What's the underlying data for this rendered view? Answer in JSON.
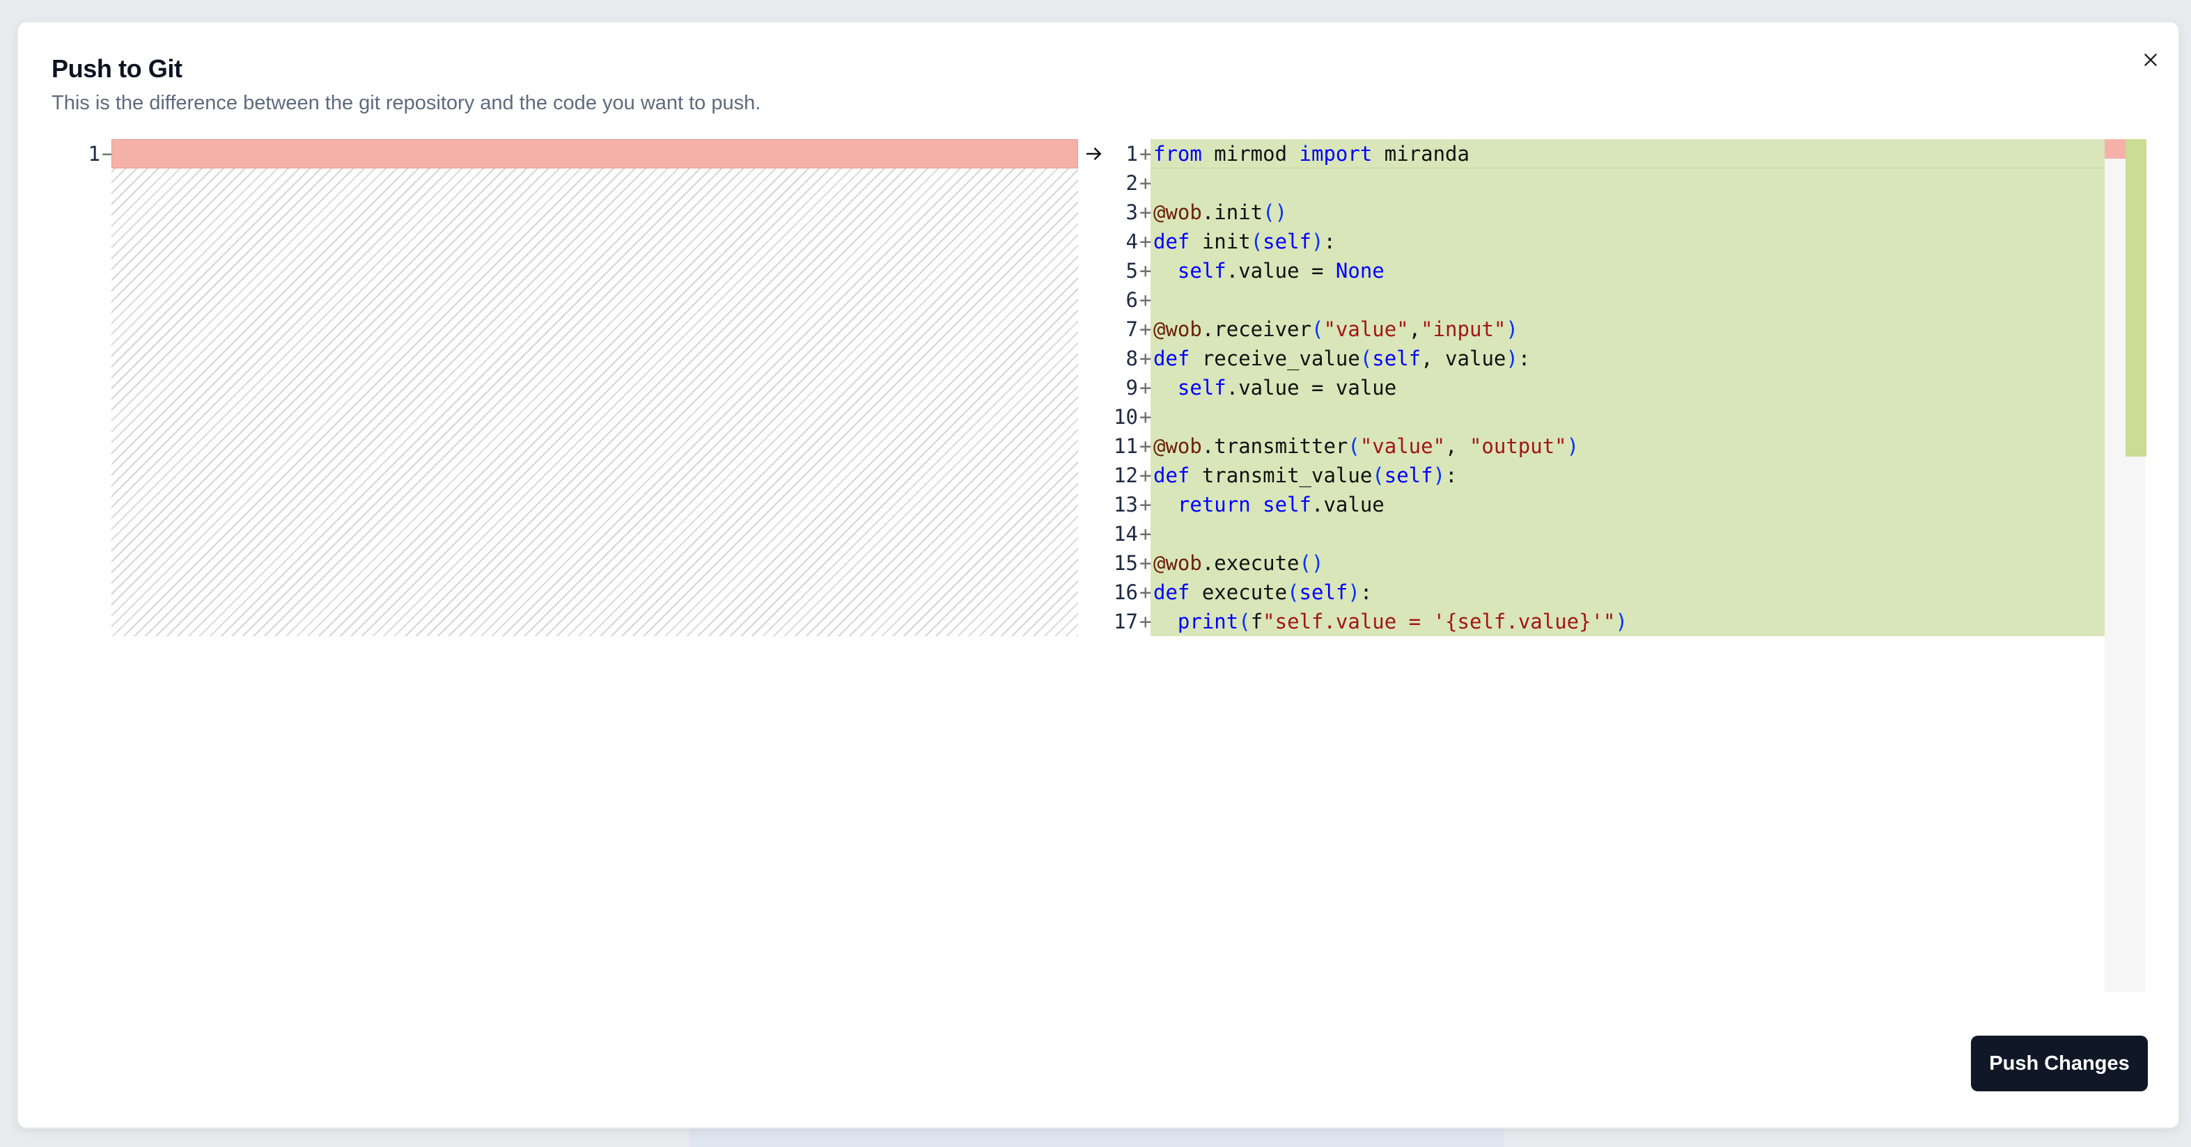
{
  "dialog": {
    "title": "Push to Git",
    "subtitle": "This is the difference between the git repository and the code you want to push."
  },
  "diff": {
    "left": {
      "lines": [
        {
          "number": "1",
          "marker": "−",
          "status": "removed",
          "text": ""
        }
      ]
    },
    "right": {
      "lines": [
        {
          "number": "1",
          "marker": "+"
        },
        {
          "number": "2",
          "marker": "+"
        },
        {
          "number": "3",
          "marker": "+"
        },
        {
          "number": "4",
          "marker": "+"
        },
        {
          "number": "5",
          "marker": "+"
        },
        {
          "number": "6",
          "marker": "+"
        },
        {
          "number": "7",
          "marker": "+"
        },
        {
          "number": "8",
          "marker": "+"
        },
        {
          "number": "9",
          "marker": "+"
        },
        {
          "number": "10",
          "marker": "+"
        },
        {
          "number": "11",
          "marker": "+"
        },
        {
          "number": "12",
          "marker": "+"
        },
        {
          "number": "13",
          "marker": "+"
        },
        {
          "number": "14",
          "marker": "+"
        },
        {
          "number": "15",
          "marker": "+"
        },
        {
          "number": "16",
          "marker": "+"
        },
        {
          "number": "17",
          "marker": "+"
        }
      ],
      "code": [
        [
          [
            "kw",
            "from"
          ],
          [
            "t",
            " mirmod "
          ],
          [
            "kw",
            "import"
          ],
          [
            "t",
            " miranda"
          ]
        ],
        [],
        [
          [
            "dec",
            "@wob"
          ],
          [
            "t",
            ".init"
          ],
          [
            "par",
            "()"
          ]
        ],
        [
          [
            "kw",
            "def"
          ],
          [
            "t",
            " init"
          ],
          [
            "par",
            "("
          ],
          [
            "kw",
            "self"
          ],
          [
            "par",
            ")"
          ],
          [
            "t",
            ":"
          ]
        ],
        [
          [
            "t",
            "  "
          ],
          [
            "kw",
            "self"
          ],
          [
            "t",
            ".value = "
          ],
          [
            "kw",
            "None"
          ]
        ],
        [],
        [
          [
            "dec",
            "@wob"
          ],
          [
            "t",
            ".receiver"
          ],
          [
            "par",
            "("
          ],
          [
            "str",
            "\"value\""
          ],
          [
            "t",
            ","
          ],
          [
            "str",
            "\"input\""
          ],
          [
            "par",
            ")"
          ]
        ],
        [
          [
            "kw",
            "def"
          ],
          [
            "t",
            " receive_value"
          ],
          [
            "par",
            "("
          ],
          [
            "kw",
            "self"
          ],
          [
            "t",
            ", value"
          ],
          [
            "par",
            ")"
          ],
          [
            "t",
            ":"
          ]
        ],
        [
          [
            "t",
            "  "
          ],
          [
            "kw",
            "self"
          ],
          [
            "t",
            ".value = value"
          ]
        ],
        [],
        [
          [
            "dec",
            "@wob"
          ],
          [
            "t",
            ".transmitter"
          ],
          [
            "par",
            "("
          ],
          [
            "str",
            "\"value\""
          ],
          [
            "t",
            ", "
          ],
          [
            "str",
            "\"output\""
          ],
          [
            "par",
            ")"
          ]
        ],
        [
          [
            "kw",
            "def"
          ],
          [
            "t",
            " transmit_value"
          ],
          [
            "par",
            "("
          ],
          [
            "kw",
            "self"
          ],
          [
            "par",
            ")"
          ],
          [
            "t",
            ":"
          ]
        ],
        [
          [
            "t",
            "  "
          ],
          [
            "kw",
            "return"
          ],
          [
            "t",
            " "
          ],
          [
            "kw",
            "self"
          ],
          [
            "t",
            ".value"
          ]
        ],
        [],
        [
          [
            "dec",
            "@wob"
          ],
          [
            "t",
            ".execute"
          ],
          [
            "par",
            "()"
          ]
        ],
        [
          [
            "kw",
            "def"
          ],
          [
            "t",
            " execute"
          ],
          [
            "par",
            "("
          ],
          [
            "kw",
            "self"
          ],
          [
            "par",
            ")"
          ],
          [
            "t",
            ":"
          ]
        ],
        [
          [
            "t",
            "  "
          ],
          [
            "kw",
            "print"
          ],
          [
            "par",
            "("
          ],
          [
            "t",
            "f"
          ],
          [
            "str",
            "\"self.value = '{self.value}'\""
          ],
          [
            "par",
            ")"
          ]
        ]
      ]
    }
  },
  "icons": {
    "close": "close-icon",
    "arrow": "arrow-right-icon"
  },
  "colors": {
    "removed_bg": "#f5b1a8",
    "added_bg": "#d9e6b9",
    "button_bg": "#101828"
  },
  "actions": {
    "push_label": "Push Changes"
  }
}
